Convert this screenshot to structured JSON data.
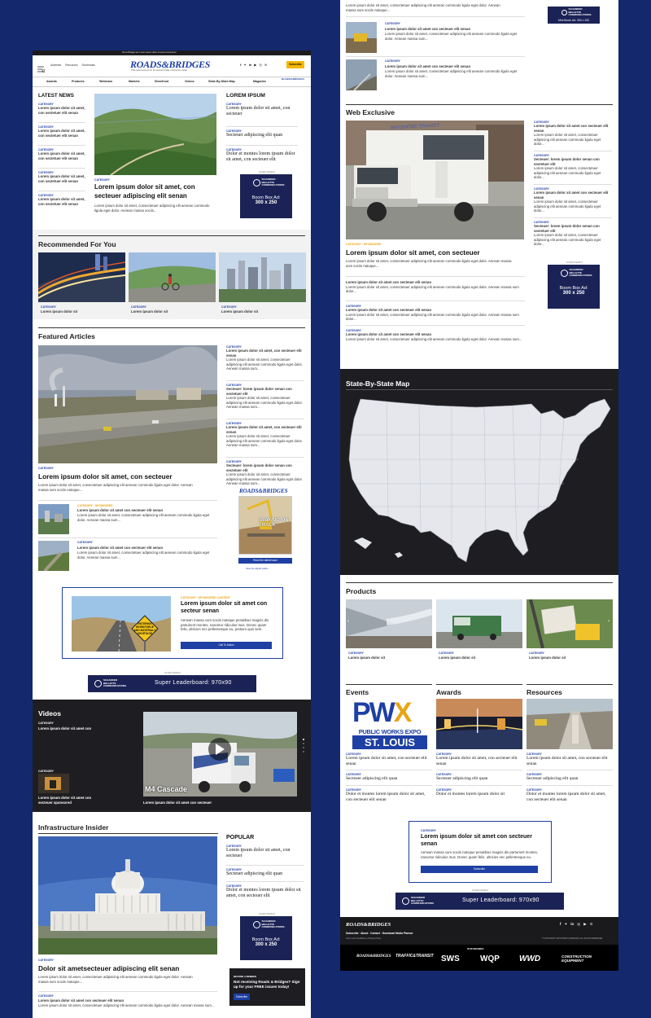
{
  "colors": {
    "background": "#14286e",
    "accent": "#1e3fa3",
    "category_highlight": "#e8a415",
    "ad": "#1b2356",
    "dark_section": "#1e1e22",
    "subscribe": "#f5b700"
  },
  "topbar": {
    "text": "Some Bridges ad. Lorem ipsum dolor sit amet consectetur"
  },
  "header": {
    "utility": [
      "Advertise",
      "Resources",
      "Shorthands"
    ],
    "logo": "ROADS&BRIDGES",
    "tagline": "THE trusted resource for the road and bridge construction market",
    "subscribe": "Subscribe",
    "social": [
      "facebook-icon",
      "twitter-icon",
      "linkedin-icon",
      "youtube-icon",
      "instagram-icon",
      "rss-icon"
    ],
    "nav": [
      "Awards",
      "Products",
      "Webinars",
      "Markets",
      "Storefront",
      "Videos",
      "State-By-State Map",
      "Magazine"
    ],
    "nav_logo": "ROADS&BRIDGES"
  },
  "latest_news": {
    "title": "LATEST NEWS",
    "items": [
      {
        "category": "CATEGORY",
        "text": "Lorem ipsum dolor sit amet, con sectetuer elit senan"
      },
      {
        "category": "CATEGORY",
        "text": "Lorem ipsum dolor sit amet, con sectetuer elit senan"
      },
      {
        "category": "CATEGORY",
        "text": "Lorem ipsum dolor sit amet, con sectetuer elit senan"
      },
      {
        "category": "CATEGORY",
        "text": "Lorem ipsum dolor sit amet, con sectetuer elit senan"
      },
      {
        "category": "CATEGORY",
        "text": "Lorem ipsum dolor sit amet, con sectetuer elit senan"
      }
    ]
  },
  "hero": {
    "category": "CATEGORY",
    "title": "Lorem ipsum dolor sit amet, con secteuer adipiscing elit senan",
    "text": "Lorem ipsum dolor sit amet, consectetuer adipiscing elit aenean commodo ligula eget dolor. Aenean massa sociis..."
  },
  "lorem_ipsum": {
    "title": "LOREM IPSUM",
    "items": [
      {
        "category": "CATEGORY",
        "text": "Lorem ipsum dolor sit amet, con secteuer"
      },
      {
        "category": "CATEGORY",
        "text": "Secteuer adipiscing elit quan"
      },
      {
        "category": "CATEGORY",
        "text": "Dolor et montes lorem ipsum dolor sit amet, con secteuer elit"
      }
    ]
  },
  "box_ad": {
    "advertisement": "ADVERTISEMENT",
    "brand": "SCHANDER BELLETTE COMMUNICATIONS",
    "label": "Boom Box Ad:",
    "size": "300 x 250"
  },
  "recommended": {
    "title": "Recommended For You",
    "items": [
      {
        "category": "CATEGORY",
        "text": "Lorem ipsum dolor sit"
      },
      {
        "category": "CATEGORY",
        "text": "Lorem ipsum dolor sit"
      },
      {
        "category": "CATEGORY",
        "text": "Lorem ipsum dolor sit"
      }
    ]
  },
  "featured": {
    "title": "Featured Articles",
    "category": "CATEGORY",
    "headline": "Lorem ipsum dolor sit amet, con secteuer",
    "text": "Lorem ipsum dolor sit amet, consectetuer adipiscing elit aenean commodo ligula eget dolor. Aenean massa sum sociis natoque...",
    "small": [
      {
        "category": "CATEGORY",
        "category2": "SPONSORED",
        "title": "Lorem ipsum dolor sit amet con secteuer elit senan",
        "text": "Lorem ipsum dolor sit amet, consectetuer adipiscing elit aenean commodo ligula eget dolor. Aenean massa sum..."
      },
      {
        "category": "CATEGORY",
        "category2": "",
        "title": "Lorem ipsum dolor sit amet con secteuer elit senan",
        "text": "Lorem ipsum dolor sit amet, consectetuer adipiscing elit aenean commodo ligula eget dolor. Aenean massa sum..."
      }
    ],
    "side": [
      {
        "category": "CATEGORY",
        "title": "Lorem ipsum dolor sit amet, con secteuer elit senan",
        "text": "Lorem ipsum dolor sit amet, consectetuer adipiscing elit aenean commodo ligula eget dolor. Aenean massa sum..."
      },
      {
        "category": "CATEGORY",
        "title": "Secteuer: lorem ipsum dolor senan con sectetuer elit",
        "text": "Lorem ipsum dolor sit amet, consectetuer adipiscing elit aenean commodo ligula eget dolor. Aenean massa sum..."
      },
      {
        "category": "CATEGORY",
        "title": "Lorem ipsum dolor sit amet, con secteuer elit senan",
        "text": "Lorem ipsum dolor sit amet, consectetuer adipiscing elit aenean commodo ligula eget dolor. Aenean massa sum..."
      },
      {
        "category": "CATEGORY",
        "title": "Secteuer: lorem ipsum dolor senan con sectetuer elit",
        "text": "Lorem ipsum dolor sit amet, consectetuer adipiscing elit aenean commodo ligula eget dolor. Aenean massa sum..."
      }
    ],
    "magazine": {
      "logo": "ROADS&BRIDGES",
      "cover_text": "STAYING ON TRACK",
      "button": "Read the latest issue",
      "link": "View the digital edition"
    }
  },
  "promo": {
    "category": "CATEGORY",
    "category2": "SPONSORED CONTENT",
    "title": "Lorem ipsum dolor sit amet con secteur senan",
    "text": "Aenean massa cum sociis natoque penatibus magnis dis parturient montes, nascetur ridiculus mus. Donec quam felis, ultricies nec pellentesque eu, pretium quis sem.",
    "button": "Call To Action",
    "sign": "ENTERING WORKFORCE AND MATERIALS SHORTAGE"
  },
  "leaderboard": {
    "advertisement": "ADVERTISEMENT",
    "brand": "SCHANDER BELLETTE COMMUNICATIONS",
    "label": "Super Leaderboard: 970x90"
  },
  "videos": {
    "title": "Videos",
    "category": "CATEGORY",
    "item1": "Lorem ipsum dolor sit amet con",
    "category2": "CATEGORY",
    "item2": "Lorem ipsum dolor sit amet con secteuer sponsored",
    "caption": "Lorem ipsum dolor sit amet con secteuer",
    "overlay": "M4 Cascade"
  },
  "infrastructure": {
    "title": "Infrastructure Insider",
    "category": "CATEGORY",
    "headline": "Dolor sit ametsecteuer adipiscing elit senan",
    "text": "Lorem ipsum dolor sit amet, consectetuer adipiscing elit aenean commodo ligula eget dolor. Aenean massa sum sociis natoque...",
    "small": {
      "category": "CATEGORY",
      "title": "Lorem ipsum dolor sit amet con secteuer elit senan",
      "text": "Lorem ipsum dolor sit amet, consectetuer adipiscing elit aenean commodo ligula eget dolor. Aenean massa sum..."
    }
  },
  "popular": {
    "title": "POPULAR",
    "items": [
      {
        "category": "CATEGORY",
        "text": "Lorem ipsum dolor sit amet, con secteuer"
      },
      {
        "category": "CATEGORY",
        "text": "Secteuer adipiscing elit quan"
      },
      {
        "category": "CATEGORY",
        "text": "Dolor et montes lorem ipsum dolor sit amet, con secteuer elit"
      }
    ]
  },
  "newsletter": {
    "title": "BECOME A MEMBER",
    "text": "Not receiving Roads & Bridges? Sign up for your FREE issues today!",
    "button": "Subscribe"
  },
  "right_top": {
    "text_top": "Lorem ipsum dolor sit amet, consectetuer adipiscing elit aenean commodo ligula eget dolor. Aenean massa sum sociis natoque...",
    "items": [
      {
        "category": "CATEGORY",
        "title": "Lorem ipsum dolor sit amet con secteuer elit senan",
        "text": "Lorem ipsum dolor sit amet, consectetuer adipiscing elit aenean commodo ligula eget dolor. Aenean massa sum..."
      },
      {
        "category": "CATEGORY",
        "title": "Lorem ipsum dolor sit amet con secteuer elit senan",
        "text": "Lorem ipsum dolor sit amet, consectetuer adipiscing elit aenean commodo ligula eget dolor. Aenean massa sum..."
      }
    ],
    "mini_ad": {
      "brand": "SCHANDER BELLETTE COMMUNICATIONS",
      "label": "Mini Boom Ad: 300 x 100"
    }
  },
  "web_exclusive": {
    "title": "Web Exclusive",
    "category": "CATEGORY",
    "category2": "SPONSORED",
    "headline": "Lorem ipsum dolor sit amet, con secteuer",
    "text": "Lorem ipsum dolor sit amet, consectetuer adipiscing elit aenean commodo ligula eget dolor. Aenean massa sum sociis natoque...",
    "list": [
      {
        "category": "CATEGORY",
        "title": "Lorem ipsum dolor sit amet con secteuer elit senan",
        "text": "Lorem ipsum dolor sit amet, consectetuer adipiscing elit aenean commodo ligula eget dolor. Aenean massa sum dolor..."
      },
      {
        "category": "CATEGORY",
        "title": "Lorem ipsum dolor sit amet con secteuer elit senan",
        "text": "Lorem ipsum dolor sit amet, consectetuer adipiscing elit aenean commodo ligula eget dolor. Aenean massa sum dolor..."
      },
      {
        "category": "CATEGORY",
        "title": "Lorem ipsum dolor sit amet con secteuer elit senan",
        "text": "Lorem ipsum dolor sit amet, consectetuer adipiscing elit aenean commodo ligula eget dolor. Aenean massa sum..."
      }
    ],
    "side": [
      {
        "category": "CATEGORY",
        "title": "Lorem ipsum dolor sit amet con secteuer elit senan",
        "text": "Lorem ipsum dolor sit amet, consectetuer adipiscing elit aenean commodo ligula eget dolor..."
      },
      {
        "category": "CATEGORY",
        "title": "Secteuer: lorem ipsum dolor senan con sectetuer elit",
        "text": "Lorem ipsum dolor sit amet, consectetuer adipiscing elit aenean commodo ligula eget dolor..."
      },
      {
        "category": "CATEGORY",
        "title": "Lorem ipsum dolor sit amet con secteuer elit senan",
        "text": "Lorem ipsum dolor sit amet, consectetuer adipiscing elit aenean commodo ligula eget dolor..."
      },
      {
        "category": "CATEGORY",
        "title": "Secteuer: lorem ipsum dolor senan con sectetuer elit",
        "text": "Lorem ipsum dolor sit amet, consectetuer adipiscing elit aenean commodo ligula eget dolor..."
      }
    ],
    "bus_text": "BAYSHORE TRANSIT"
  },
  "state_map": {
    "title": "State-By-State Map"
  },
  "products": {
    "title": "Products",
    "items": [
      {
        "category": "CATEGORY",
        "text": "Lorem ipsum dolor sit"
      },
      {
        "category": "CATEGORY",
        "text": "Lorem ipsum dolor sit"
      },
      {
        "category": "CATEGORY",
        "text": "Lorem ipsum dolor sit"
      }
    ]
  },
  "triple": [
    {
      "title": "Events",
      "items": [
        {
          "category": "CATEGORY",
          "text": "Lorem ipsum dolor sit amet, con secteuer elit senan"
        },
        {
          "category": "CATEGORY",
          "text": "Secteuer adipiscing elit quan"
        },
        {
          "category": "CATEGORY",
          "text": "Dolor et montes lorem ipsum dolor sit amet, con secteuer elit senan"
        }
      ]
    },
    {
      "title": "Awards",
      "items": [
        {
          "category": "CATEGORY",
          "text": "Lorem ipsum dolor sit amet, con secteuer elit senan"
        },
        {
          "category": "CATEGORY",
          "text": "Secteuer adipiscing elit quan"
        },
        {
          "category": "CATEGORY",
          "text": "Dolor et montes lorem ipsum dolor sit"
        }
      ]
    },
    {
      "title": "Resources",
      "items": [
        {
          "category": "CATEGORY",
          "text": "Lorem ipsum dolor sit amet, con secteuer elit senan"
        },
        {
          "category": "CATEGORY",
          "text": "Secteuer adipiscing elit quan"
        },
        {
          "category": "CATEGORY",
          "text": "Dolor et montes lorem ipsum dolor sit amet, con secteuer elit senan"
        }
      ]
    }
  ],
  "pwx": {
    "line1": "PW",
    "line1b": "X",
    "line2": "PUBLIC WORKS EXPO",
    "line3": "ST. LOUIS"
  },
  "promo2": {
    "category": "CATEGORY",
    "title": "Lorem ipsum dolor sit amet con secteuer senan",
    "text": "Aenean massa cum sociis natoque penatibus magnis dis parturient montes, nascetur ridiculus mus. Donec quam felis, ultricies nec pellentesque eu.",
    "button": "Subscribe"
  },
  "footer": {
    "logo": "ROADS&BRIDGES",
    "links": "Subscribe · About · Contact · Download Media Planner",
    "legal": "Terms and Conditions | Privacy Policy",
    "copyright": "© COPYRIGHT 2023 ROADS & BRIDGES. ALL RIGHTS RESERVED.",
    "our_brands": "OUR BRANDS",
    "brands": [
      "ROADS&BRIDGES",
      "TRAFFIC&TRANSIT",
      "SWS",
      "WQP",
      "WWD",
      "CONSTRUCTION EQUIPMENT"
    ]
  }
}
